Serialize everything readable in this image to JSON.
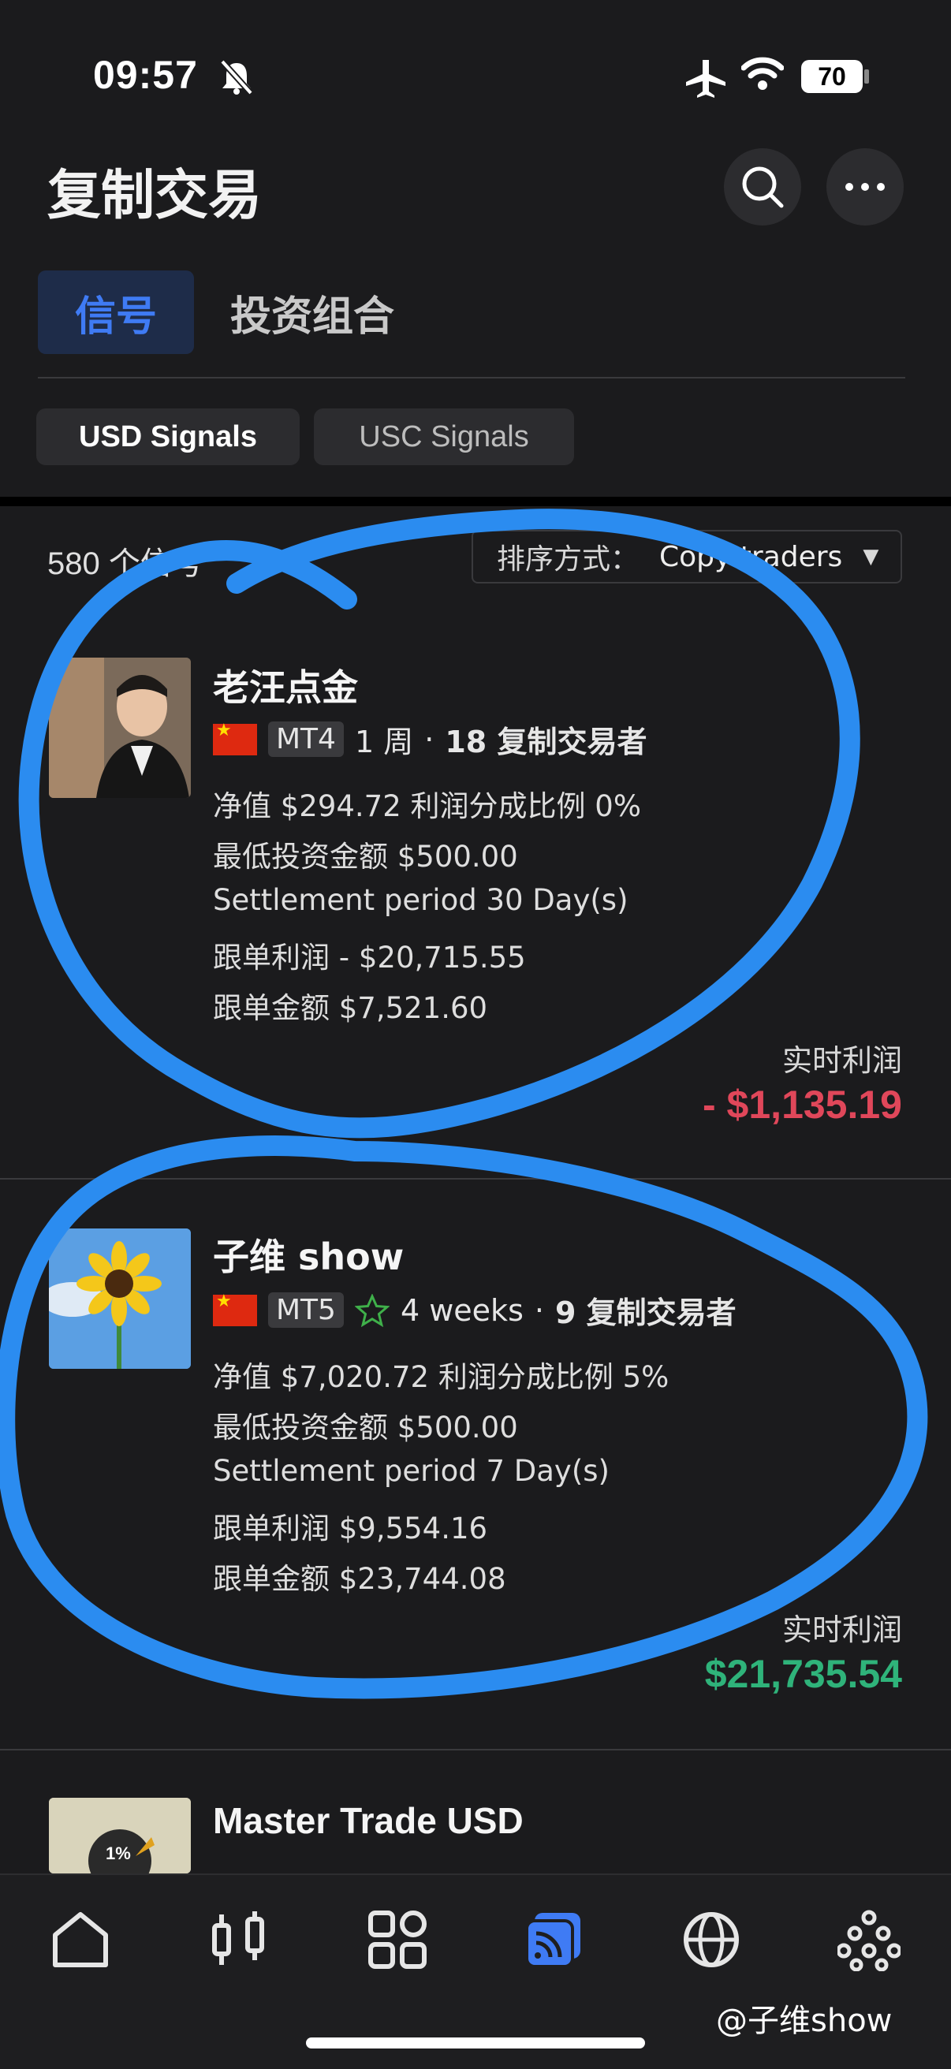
{
  "status": {
    "time": "09:57",
    "battery": "70"
  },
  "header": {
    "title": "复制交易"
  },
  "tabs": [
    {
      "label": "信号"
    },
    {
      "label": "投资组合"
    }
  ],
  "pills": [
    {
      "label": "USD Signals"
    },
    {
      "label": "USC Signals"
    }
  ],
  "list": {
    "count_text": "580 个信号",
    "sort_label": "排序方式：",
    "sort_value": "Copy traders"
  },
  "signals": [
    {
      "name": "老汪点金",
      "platform": "MT4",
      "period": "1 周",
      "sep": "·",
      "copiers": "18 复制交易者",
      "line1": "净值 $294.72  利润分成比例 0%",
      "line2": "最低投资金额 $500.00",
      "line3": "Settlement period 30 Day(s)",
      "line4": "跟单利润 - $20,715.55",
      "line5": "跟单金额 $7,521.60",
      "pl_label": "实时利润",
      "pl_value": "- $1,135.19",
      "pl_color": "#e0475a"
    },
    {
      "name": "子维 show",
      "platform": "MT5",
      "period": "4 weeks",
      "sep": "·",
      "copiers": "9 复制交易者",
      "line1": "净值 $7,020.72  利润分成比例 5%",
      "line2": "最低投资金额 $500.00",
      "line3": "Settlement period 7 Day(s)",
      "line4": "跟单利润 $9,554.16",
      "line5": "跟单金额 $23,744.08",
      "pl_label": "实时利润",
      "pl_value": "$21,735.54",
      "pl_color": "#2fb37a"
    },
    {
      "name": "Master Trade USD",
      "badge": "1%"
    }
  ],
  "watermark": "@子维show",
  "colors": {
    "accent": "#3f7bf4",
    "annotation": "#2b8cf0",
    "loss": "#e0475a",
    "gain": "#2fb37a"
  }
}
